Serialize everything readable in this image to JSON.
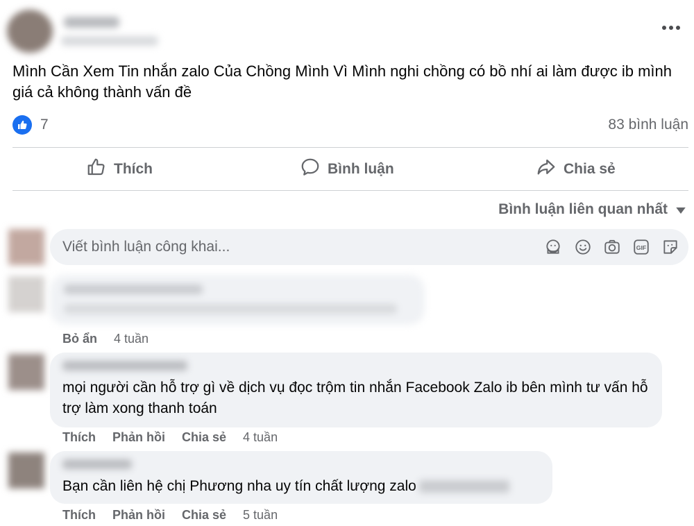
{
  "post": {
    "text": "Mình Cần Xem Tin nhắn zalo Của Chồng Mình Vì Mình nghi chồng có bồ nhí ai làm được ib mình giá cả không thành vấn đề",
    "like_count": "7",
    "comment_count": "83 bình luận",
    "more_icon": "more-horizontal-icon"
  },
  "actions": {
    "like": "Thích",
    "comment": "Bình luận",
    "share": "Chia sẻ"
  },
  "sort": {
    "label": "Bình luận liên quan nhất"
  },
  "composer": {
    "placeholder": "Viết bình luận công khai...",
    "tools": [
      "avatar-sticker-icon",
      "emoji-icon",
      "camera-icon",
      "gif-icon",
      "sticker-icon"
    ]
  },
  "comments": [
    {
      "hidden_label": "Bỏ ẩn",
      "time": "4 tuần"
    },
    {
      "text": "mọi người cần hỗ trợ gì về dịch vụ đọc trộm tin nhắn Facebook Zalo ib bên mình tư vấn hỗ trợ làm xong thanh toán",
      "like": "Thích",
      "reply": "Phản hồi",
      "share": "Chia sẻ",
      "time": "4 tuần"
    },
    {
      "text": "Bạn cần liên hệ chị Phương nha uy tín chất lượng zalo",
      "like": "Thích",
      "reply": "Phản hồi",
      "share": "Chia sẻ",
      "time": "5 tuần"
    }
  ],
  "colors": {
    "accent": "#1a6ff0",
    "secondary_text": "#65676b",
    "bubble": "#f0f2f5"
  }
}
